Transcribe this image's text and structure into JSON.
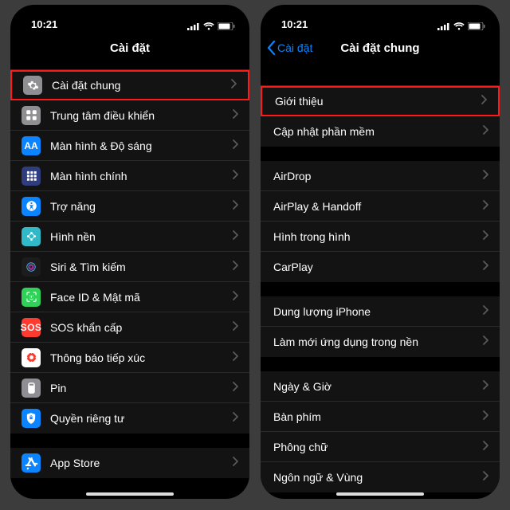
{
  "statusbar": {
    "time": "10:21"
  },
  "left": {
    "title": "Cài đặt",
    "groups": [
      {
        "rows": [
          {
            "icon": "gear-icon",
            "iconClass": "ic-gear",
            "label": "Cài đặt chung",
            "highlight": true
          },
          {
            "icon": "control-center-icon",
            "iconClass": "ic-ctrl",
            "label": "Trung tâm điều khiển"
          },
          {
            "icon": "display-icon",
            "iconClass": "ic-display",
            "label": "Màn hình & Độ sáng",
            "iconText": "AA"
          },
          {
            "icon": "home-screen-icon",
            "iconClass": "ic-home",
            "label": "Màn hình chính"
          },
          {
            "icon": "accessibility-icon",
            "iconClass": "ic-access",
            "label": "Trợ năng"
          },
          {
            "icon": "wallpaper-icon",
            "iconClass": "ic-wall",
            "label": "Hình nền"
          },
          {
            "icon": "siri-icon",
            "iconClass": "ic-siri",
            "label": "Siri & Tìm kiếm"
          },
          {
            "icon": "faceid-icon",
            "iconClass": "ic-faceid",
            "label": "Face ID & Mật mã"
          },
          {
            "icon": "sos-icon",
            "iconClass": "ic-sos",
            "label": "SOS khẩn cấp",
            "iconText": "SOS"
          },
          {
            "icon": "exposure-icon",
            "iconClass": "ic-expose",
            "label": "Thông báo tiếp xúc"
          },
          {
            "icon": "pin-icon",
            "iconClass": "ic-pin",
            "label": "Pin"
          },
          {
            "icon": "privacy-icon",
            "iconClass": "ic-privacy",
            "label": "Quyền riêng tư"
          }
        ]
      },
      {
        "rows": [
          {
            "icon": "appstore-icon",
            "iconClass": "ic-appstore",
            "label": "App Store"
          }
        ]
      }
    ]
  },
  "right": {
    "back": "Cài đặt",
    "title": "Cài đặt chung",
    "groups": [
      {
        "rows": [
          {
            "label": "Giới thiệu",
            "highlight": true
          },
          {
            "label": "Cập nhật phần mềm"
          }
        ]
      },
      {
        "rows": [
          {
            "label": "AirDrop"
          },
          {
            "label": "AirPlay & Handoff"
          },
          {
            "label": "Hình trong hình"
          },
          {
            "label": "CarPlay"
          }
        ]
      },
      {
        "rows": [
          {
            "label": "Dung lượng iPhone"
          },
          {
            "label": "Làm mới ứng dụng trong nền"
          }
        ]
      },
      {
        "rows": [
          {
            "label": "Ngày & Giờ"
          },
          {
            "label": "Bàn phím"
          },
          {
            "label": "Phông chữ"
          },
          {
            "label": "Ngôn ngữ & Vùng"
          }
        ]
      }
    ]
  },
  "icons": {
    "chevron_right": "›",
    "chevron_left": "‹"
  }
}
